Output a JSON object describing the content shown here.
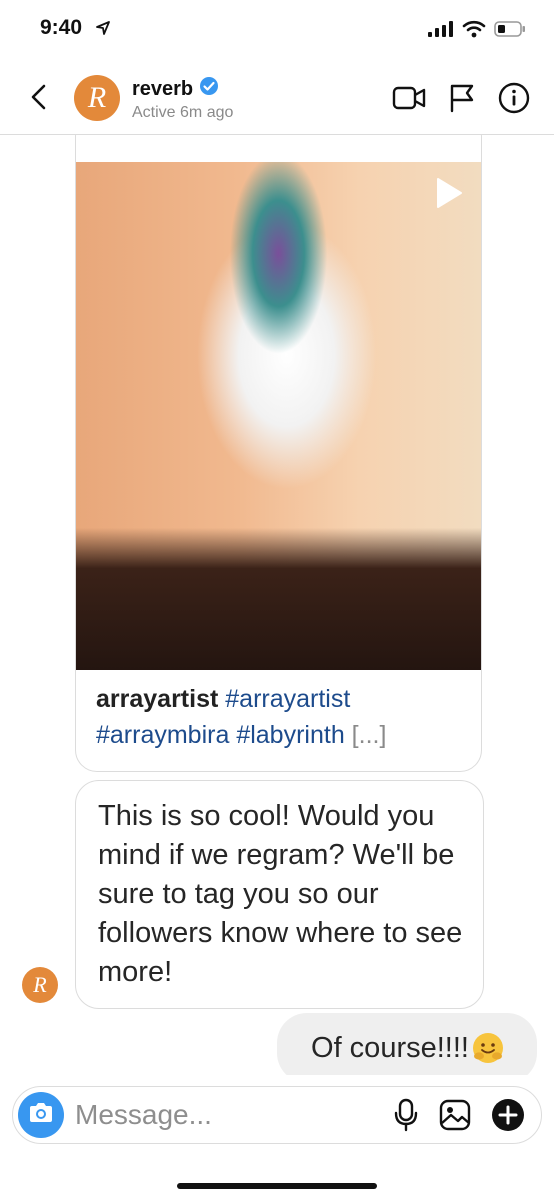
{
  "status_bar": {
    "time": "9:40"
  },
  "header": {
    "avatar_letter": "R",
    "username": "reverb",
    "status": "Active 6m ago",
    "verified_icon": "verified-badge-icon",
    "icons": [
      "back-chevron-icon",
      "video-call-icon",
      "flag-icon",
      "info-icon"
    ]
  },
  "post": {
    "username": "arrayartist",
    "hashtags_line1": "#arrayartist",
    "hashtags_line2": "#arraymbira #labyrinth",
    "more": "[...]",
    "play_icon": "play-icon"
  },
  "messages": [
    {
      "direction": "incoming",
      "text": "This is so cool! Would you mind if we regram? We'll be sure to tag you so our followers know where to see more!",
      "avatar_letter": "R"
    },
    {
      "direction": "outgoing",
      "text": "Of course!!!!",
      "emoji_icon": "hugging-face-emoji-icon"
    }
  ],
  "composer": {
    "placeholder": "Message...",
    "icons": [
      "camera-icon",
      "microphone-icon",
      "gallery-icon",
      "plus-icon"
    ]
  },
  "colors": {
    "brand_orange": "#e3893a",
    "link_blue": "#1d4b8c",
    "camera_blue": "#3897f0",
    "verified_blue": "#3897f0"
  }
}
